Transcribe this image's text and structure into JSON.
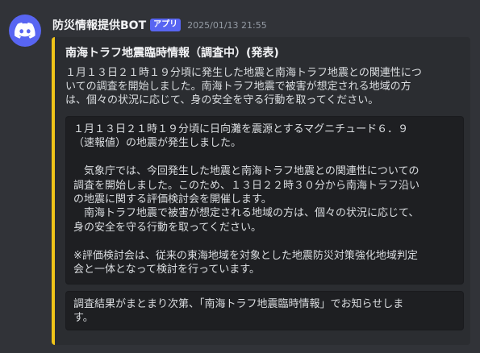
{
  "message": {
    "author": "防災情報提供BOT",
    "badge": "アプリ",
    "timestamp": "2025/01/13 21:55"
  },
  "embed": {
    "accent_color": "#f0c419",
    "title": "南海トラフ地震臨時情報（調査中）(発表)",
    "description": "１月１３日２１時１９分頃に発生した地震と南海トラフ地震との関連性につ\nいての調査を開始しました。南海トラフ地震で被害が想定される地域の方\nは、個々の状況に応じて、身の安全を守る行動を取ってください。",
    "code_block_1": "１月１３日２１時１９分頃に日向灘を震源とするマグニチュード６．９\n（速報値）の地震が発生しました。\n\n　気象庁では、今回発生した地震と南海トラフ地震との関連性についての\n調査を開始しました。このため、１３日２２時３０分から南海トラフ沿い\nの地震に関する評価検討会を開催します。\n　南海トラフ地震で被害が想定される地域の方は、個々の状況に応じて、\n身の安全を守る行動を取ってください。\n\n※評価検討会は、従来の東海地域を対象とした地震防災対策強化地域判定\n会と一体となって検討を行っています。",
    "code_block_2": "調査結果がまとまり次第、「南海トラフ地震臨時情報」でお知らせしま\nす。"
  },
  "avatar": {
    "icon": "discord-logo-icon",
    "color": "#5865f2"
  }
}
